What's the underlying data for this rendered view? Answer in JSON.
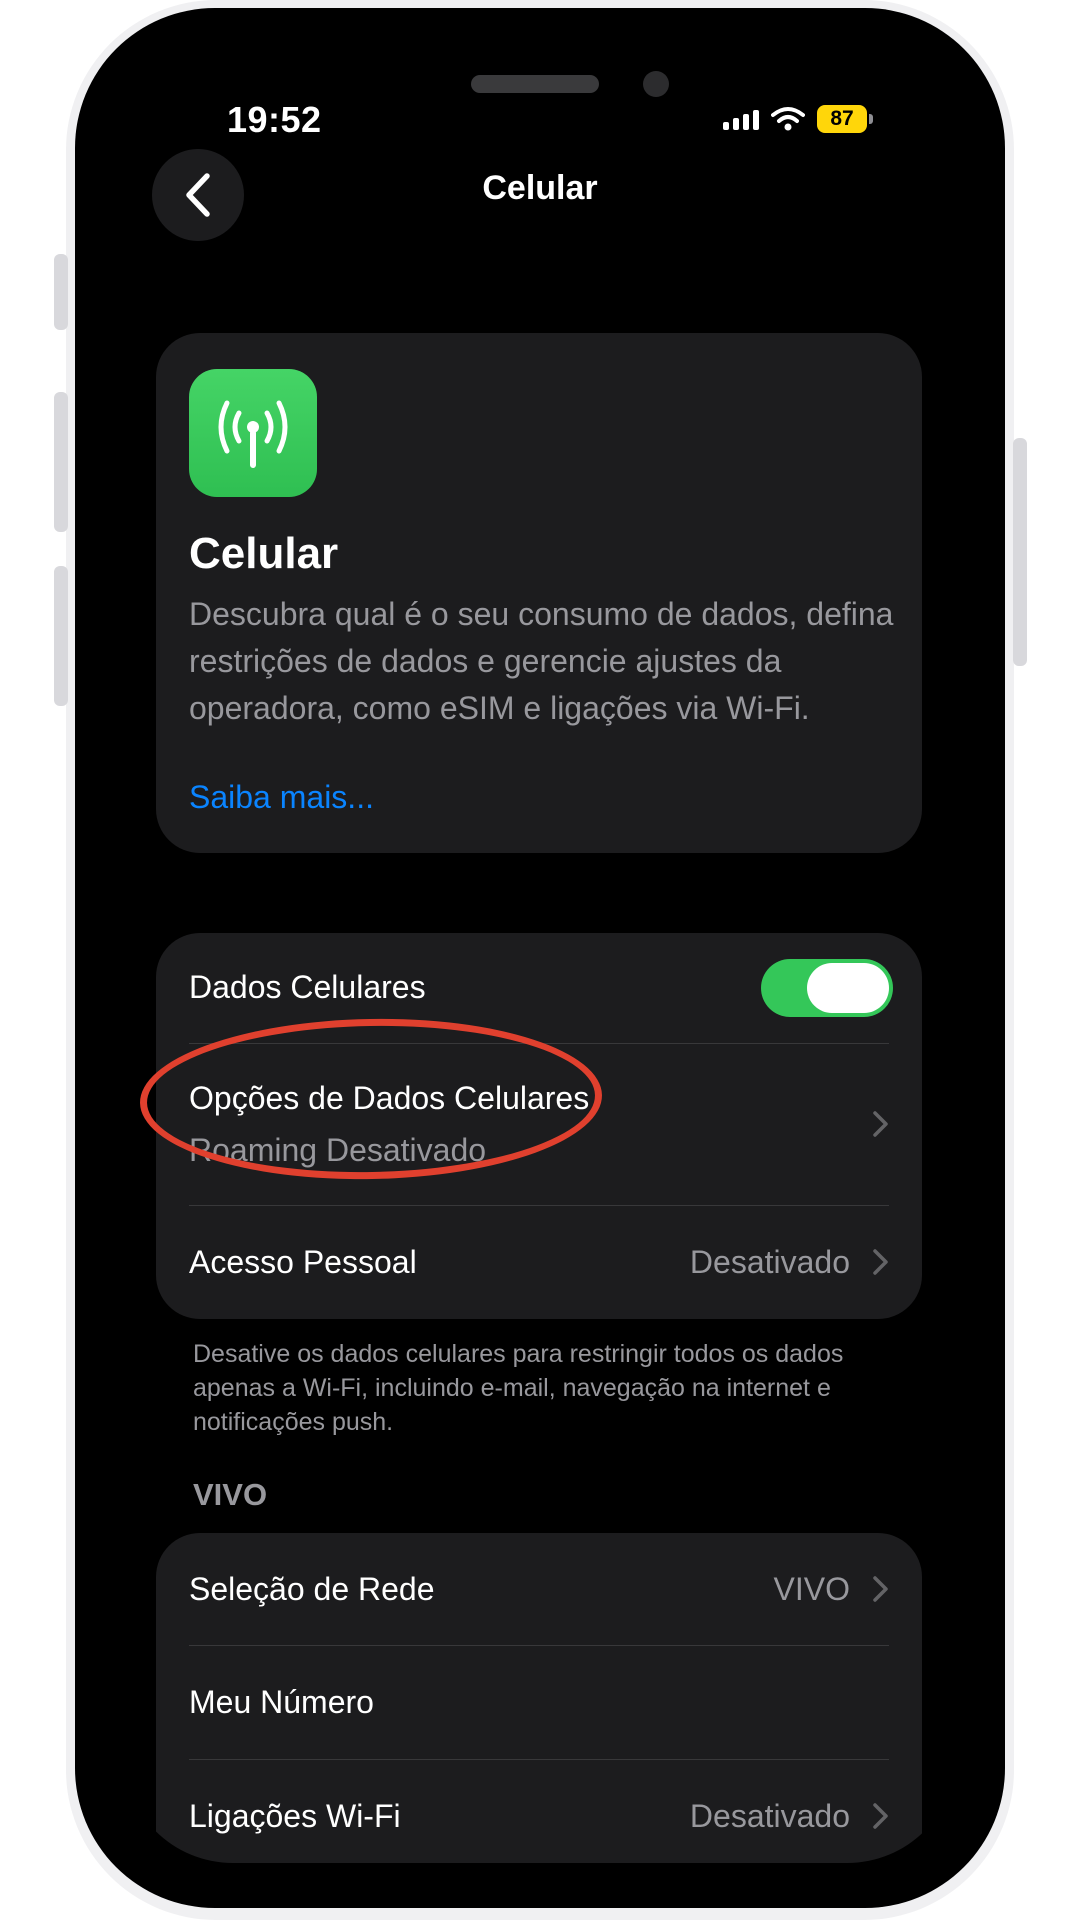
{
  "status": {
    "time": "19:52",
    "battery": "87"
  },
  "nav": {
    "title": "Celular"
  },
  "hero": {
    "title": "Celular",
    "description": "Descubra qual é o seu consumo de dados, defina restrições de dados e gerencie ajustes da operadora, como eSIM e ligações via Wi-Fi.",
    "link": "Saiba mais..."
  },
  "data_section": {
    "dados_celulares": {
      "label": "Dados Celulares",
      "enabled": true
    },
    "opcoes": {
      "label": "Opções de Dados Celulares",
      "sub": "Roaming Desativado"
    },
    "acesso": {
      "label": "Acesso Pessoal",
      "value": "Desativado"
    },
    "footnote": "Desative os dados celulares para restringir todos os dados apenas a Wi-Fi, incluindo e-mail, navegação na internet e notificações push."
  },
  "carrier_section": {
    "header": "VIVO",
    "rows": [
      {
        "label": "Seleção de Rede",
        "value": "VIVO"
      },
      {
        "label": "Meu Número",
        "value": ""
      },
      {
        "label": "Ligações Wi-Fi",
        "value": "Desativado"
      }
    ]
  },
  "colors": {
    "accent_link": "#0a84ff",
    "toggle_on": "#34c759",
    "annotation": "#e0402e",
    "battery": "#ffd60a"
  }
}
